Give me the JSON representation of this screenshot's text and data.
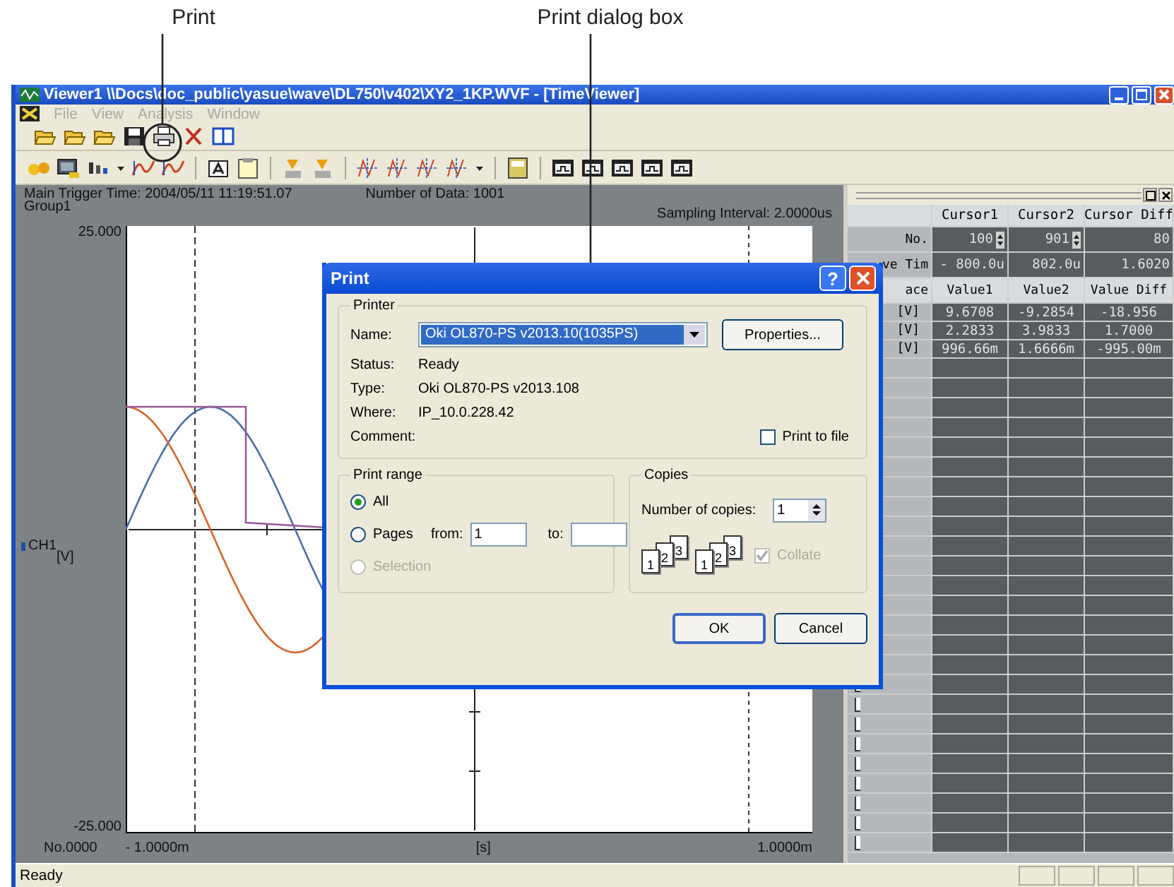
{
  "callouts": [
    {
      "label": "Print"
    },
    {
      "label": "Print dialog box"
    }
  ],
  "window": {
    "title": "Viewer1 \\\\Docs\\doc_public\\yasue\\wave\\DL750\\v402\\XY2_1KP.WVF - [TimeViewer]"
  },
  "menu": [
    {
      "label": "File",
      "disabled": true
    },
    {
      "label": "View",
      "disabled": true
    },
    {
      "label": "Analysis",
      "disabled": true
    },
    {
      "label": "Window",
      "disabled": true
    }
  ],
  "chart": {
    "trigger_time": "Main  Trigger Time: 2004/05/11 11:19:51.07",
    "group": "Group1",
    "data_count": "Number of Data: 1001",
    "sampling": "Sampling Interval: 2.0000us",
    "y_max": "25.000",
    "y_min": "-25.000",
    "channel": "CH1",
    "channel_unit": "[V]",
    "sample_no": "No.0000",
    "x_min": "- 1.0000m",
    "x_unit": "[s]",
    "x_max": "1.0000m"
  },
  "cursor_table": {
    "columns": [
      "Cursor1",
      "Cursor2",
      "Cursor Diff"
    ],
    "rows": [
      {
        "label": "No.",
        "kind": "spinner",
        "values": [
          "100",
          "901",
          "80"
        ]
      },
      {
        "label": "ve Tim",
        "kind": "plain",
        "values": [
          "- 800.0u",
          "802.0u",
          "1.6020"
        ]
      }
    ],
    "trace_header": {
      "label": "ace",
      "columns": [
        "Value1",
        "Value2",
        "Value Diff"
      ]
    },
    "trace_rows": [
      {
        "label": "[V]",
        "values": [
          "9.6708",
          "-9.2854",
          "-18.956"
        ]
      },
      {
        "label": "[V]",
        "values": [
          "2.2833",
          "3.9833",
          "1.7000"
        ]
      },
      {
        "label": "[V]",
        "values": [
          "996.66m",
          "1.6666m",
          "-995.00m"
        ]
      }
    ]
  },
  "dialog": {
    "title": "Print",
    "help_button": "?",
    "printer": {
      "legend": "Printer",
      "name_label": "Name:",
      "name_value": "Oki OL870-PS v2013.10(1035PS)",
      "properties_button": "Properties...",
      "info": [
        {
          "label": "Status:",
          "value": "Ready"
        },
        {
          "label": "Type:",
          "value": "Oki OL870-PS v2013.108"
        },
        {
          "label": "Where:",
          "value": "IP_10.0.228.42"
        },
        {
          "label": "Comment:"
        }
      ],
      "print_to_file": {
        "label": "Print to file",
        "checked": false
      }
    },
    "print_range": {
      "legend": "Print range",
      "options": [
        {
          "label": "All",
          "selected": true,
          "disabled": false
        },
        {
          "label": "Pages",
          "selected": false,
          "disabled": false
        },
        {
          "label": "Selection",
          "selected": false,
          "disabled": true
        }
      ],
      "from_label": "from:",
      "from_value": "1",
      "to_label": "to:"
    },
    "copies": {
      "legend": "Copies",
      "count_label": "Number of copies:",
      "count_value": "1",
      "collate_stacks": [
        [
          "1",
          "2",
          "3"
        ],
        [
          "1",
          "2",
          "3"
        ]
      ],
      "collate": {
        "label": "Collate",
        "checked": true,
        "disabled": true
      }
    },
    "buttons": [
      {
        "label": "OK",
        "default": true
      },
      {
        "label": "Cancel",
        "default": false
      }
    ]
  },
  "status_bar": {
    "text": "Ready"
  }
}
